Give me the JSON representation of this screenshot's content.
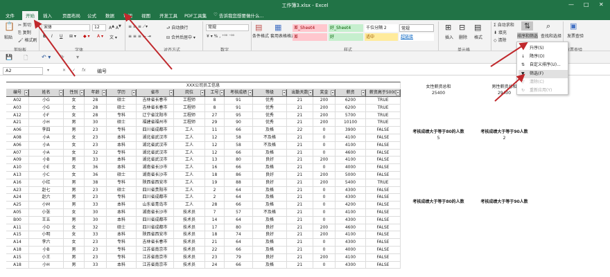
{
  "title": "工作簿3.xlsx - Excel",
  "tabs": [
    "文件",
    "开始",
    "插入",
    "页面布局",
    "公式",
    "数据",
    "审阅",
    "视图",
    "开发工具",
    "PDF工具集"
  ],
  "tell_me": "告诉我您想要做什么...",
  "ribbon": {
    "paste": "粘贴",
    "cut": "剪切",
    "copy": "复制",
    "format_painter": "格式刷",
    "font_name": "宋体",
    "font_size": "12",
    "bold": "B",
    "italic": "I",
    "underline": "U",
    "wrap": "自动换行",
    "merge": "合并后居中",
    "number_format": "常规",
    "cond_format": "条件格式",
    "table_format": "套用表格格式",
    "styles": [
      "差_Sheet4",
      "好_Sheet4",
      "千位分隔 2",
      "常规",
      "差",
      "好",
      "适中",
      "超链接"
    ],
    "insert": "插入",
    "delete": "删除",
    "format": "格式",
    "autosum": "自动求和",
    "fill": "填充",
    "clear": "清除",
    "sort_filter": "排序和筛选",
    "find_select": "查找和选择",
    "invoice": "发票查验",
    "groups": [
      "剪贴板",
      "字体",
      "对齐方式",
      "数字",
      "样式",
      "单元格",
      "编辑",
      "发票查验"
    ]
  },
  "namebox": "A2",
  "formula": "编号",
  "table_title": "XXX公司员工信息",
  "headers": [
    "编号",
    "姓名",
    "性别",
    "年龄",
    "学历",
    "省市",
    "岗位",
    "工号",
    "考核成绩",
    "等级",
    "出勤天数",
    "奖金",
    "薪资",
    "薪资高于5000"
  ],
  "rows": [
    [
      "A02",
      "小G",
      "女",
      "28",
      "硕士",
      "吉林省长春市",
      "工程师",
      "8",
      "91",
      "优秀",
      "21",
      "200",
      "6200",
      "TRUE"
    ],
    [
      "A03",
      "小G",
      "女",
      "28",
      "硕士",
      "吉林省长春市",
      "工程师",
      "8",
      "91",
      "优秀",
      "21",
      "200",
      "6200",
      "TRUE"
    ],
    [
      "A12",
      "小F",
      "女",
      "28",
      "专科",
      "辽宁省沈阳市",
      "工程师",
      "27",
      "95",
      "优秀",
      "21",
      "200",
      "5700",
      "TRUE"
    ],
    [
      "A21",
      "小H",
      "男",
      "30",
      "硕士",
      "福建省福州市",
      "工程师",
      "29",
      "90",
      "优秀",
      "21",
      "200",
      "10100",
      "TRUE"
    ],
    [
      "A06",
      "李四",
      "男",
      "23",
      "专科",
      "四川省成都市",
      "工人",
      "11",
      "66",
      "及格",
      "22",
      "0",
      "3900",
      "FALSE"
    ],
    [
      "A08",
      "小A",
      "女",
      "23",
      "本科",
      "湖北省武汉市",
      "工人",
      "12",
      "58",
      "不及格",
      "21",
      "0",
      "4100",
      "FALSE"
    ],
    [
      "A06",
      "小A",
      "女",
      "23",
      "本科",
      "湖北省武汉市",
      "工人",
      "12",
      "58",
      "不及格",
      "21",
      "0",
      "4100",
      "FALSE"
    ],
    [
      "A07",
      "小A",
      "女",
      "32",
      "专科",
      "湖北省武汉市",
      "工人",
      "12",
      "66",
      "及格",
      "21",
      "0",
      "4600",
      "FALSE"
    ],
    [
      "A09",
      "小B",
      "男",
      "33",
      "本科",
      "湖北省武汉市",
      "工人",
      "13",
      "80",
      "良好",
      "21",
      "200",
      "4100",
      "FALSE"
    ],
    [
      "A10",
      "小E",
      "女",
      "36",
      "本科",
      "湖南省长沙市",
      "工人",
      "16",
      "66",
      "及格",
      "21",
      "0",
      "4000",
      "FALSE"
    ],
    [
      "A13",
      "小C",
      "女",
      "36",
      "硕士",
      "湖南省长沙市",
      "工人",
      "18",
      "86",
      "良好",
      "21",
      "200",
      "5000",
      "FALSE"
    ],
    [
      "A16",
      "小红",
      "男",
      "38",
      "专科",
      "陕西省西安市",
      "工人",
      "19",
      "88",
      "良好",
      "21",
      "200",
      "5400",
      "TRUE"
    ],
    [
      "A23",
      "赵七",
      "男",
      "23",
      "硕士",
      "四川省贵阳市",
      "工人",
      "2",
      "64",
      "及格",
      "21",
      "0",
      "4300",
      "FALSE"
    ],
    [
      "A24",
      "赵六",
      "男",
      "23",
      "专科",
      "四川省成都市",
      "工人",
      "2",
      "64",
      "及格",
      "21",
      "0",
      "4300",
      "FALSE"
    ],
    [
      "A25",
      "小M",
      "男",
      "33",
      "本科",
      "山东省青岛市",
      "工人",
      "28",
      "66",
      "及格",
      "21",
      "0",
      "4200",
      "FALSE"
    ],
    [
      "A05",
      "小张",
      "女",
      "30",
      "本科",
      "湖南省长沙市",
      "技术员",
      "7",
      "57",
      "不及格",
      "21",
      "0",
      "4100",
      "FALSE"
    ],
    [
      "B00",
      "王五",
      "男",
      "30",
      "本科",
      "四川省成都市",
      "技术员",
      "14",
      "64",
      "及格",
      "21",
      "0",
      "4300",
      "FALSE"
    ],
    [
      "A11",
      "小D",
      "女",
      "32",
      "硕士",
      "四川省成都市",
      "技术员",
      "17",
      "80",
      "良好",
      "21",
      "200",
      "4600",
      "FALSE"
    ],
    [
      "A15",
      "小明",
      "女",
      "33",
      "本科",
      "陕西省西安市",
      "技术员",
      "18",
      "74",
      "良好",
      "21",
      "200",
      "4100",
      "FALSE"
    ],
    [
      "A14",
      "李六",
      "女",
      "23",
      "专科",
      "吉林省长春市",
      "技术员",
      "21",
      "64",
      "及格",
      "21",
      "0",
      "4300",
      "FALSE"
    ],
    [
      "A18",
      "小B",
      "男",
      "23",
      "专科",
      "江苏省南京市",
      "技术员",
      "22",
      "66",
      "及格",
      "21",
      "0",
      "4000",
      "FALSE"
    ],
    [
      "A15",
      "小王",
      "男",
      "23",
      "专科",
      "江苏省南京市",
      "技术员",
      "23",
      "79",
      "良好",
      "21",
      "200",
      "4100",
      "FALSE"
    ],
    [
      "A18",
      "小H",
      "男",
      "33",
      "本科",
      "江苏省南京市",
      "技术员",
      "24",
      "66",
      "及格",
      "21",
      "0",
      "4300",
      "FALSE"
    ]
  ],
  "side": {
    "female_total_label": "女性薪资总和",
    "male_total_label": "男性薪资总和",
    "female_total": "25400",
    "male_total": "29400",
    "score80_label": "考核成绩大于等于80的人数",
    "score90_label": "考核成绩大于等于90人数",
    "score80": "5",
    "score90": "2"
  },
  "menu": [
    "升序(S)",
    "降序(O)",
    "自定义排序(U)...",
    "筛选(F)",
    "清除(C)",
    "重新应用(Y)"
  ],
  "colors": {
    "excel_green": "#217346",
    "arrow_red": "#c0282c",
    "header_gray": "#d9d9d9"
  }
}
